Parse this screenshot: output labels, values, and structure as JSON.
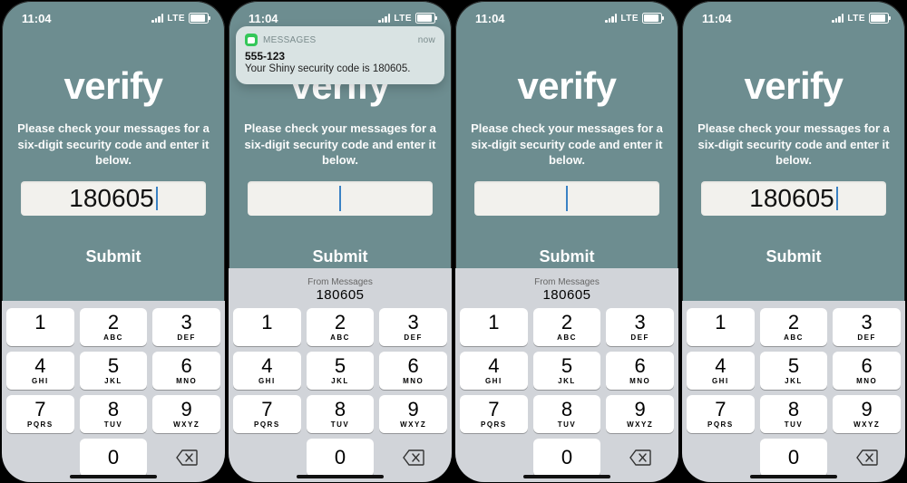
{
  "status": {
    "time": "11:04",
    "carrier": "LTE"
  },
  "title": "verify",
  "instruction": "Please check your messages for a six-digit security code and enter it below.",
  "submit_label": "Submit",
  "keypad": {
    "keys": [
      {
        "digit": "1",
        "letters": ""
      },
      {
        "digit": "2",
        "letters": "ABC"
      },
      {
        "digit": "3",
        "letters": "DEF"
      },
      {
        "digit": "4",
        "letters": "GHI"
      },
      {
        "digit": "5",
        "letters": "JKL"
      },
      {
        "digit": "6",
        "letters": "MNO"
      },
      {
        "digit": "7",
        "letters": "PQRS"
      },
      {
        "digit": "8",
        "letters": "TUV"
      },
      {
        "digit": "9",
        "letters": "WXYZ"
      }
    ],
    "zero": "0"
  },
  "suggestion": {
    "from_label": "From Messages",
    "code": "180605"
  },
  "notification": {
    "app": "MESSAGES",
    "time": "now",
    "sender": "555-123",
    "body": "Your Shiny security code is 180605."
  },
  "screens": [
    {
      "entered_code": "180605",
      "has_notification": false,
      "has_suggestion": false
    },
    {
      "entered_code": "",
      "has_notification": true,
      "has_suggestion": true
    },
    {
      "entered_code": "",
      "has_notification": false,
      "has_suggestion": true
    },
    {
      "entered_code": "180605",
      "has_notification": false,
      "has_suggestion": false
    }
  ]
}
